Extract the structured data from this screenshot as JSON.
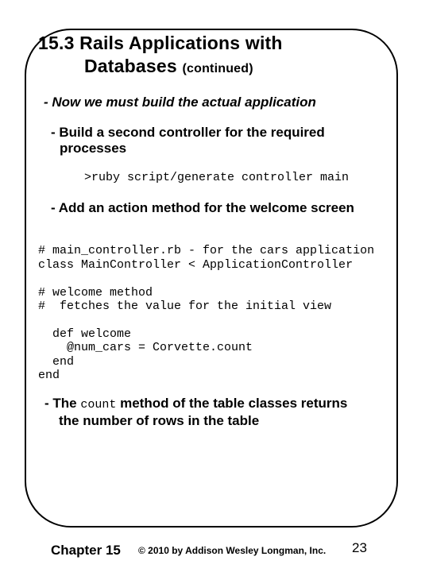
{
  "slide": {
    "title_line1": "15.3 Rails Applications with",
    "title_line2": "Databases",
    "title_suffix": "(continued)",
    "bullets": {
      "main": "- Now we must build the actual application",
      "sub1_line1": "- Build a second controller for the required",
      "sub1_line2": "processes",
      "command": ">ruby script/generate controller main",
      "sub2": "- Add an action method for the welcome screen",
      "sub3_prefix": "- The",
      "sub3_code": "count",
      "sub3_suffix": "method of the table classes returns",
      "sub3_line2": "the number of rows in the table"
    },
    "code_lines": [
      "# main_controller.rb - for the cars application",
      "class MainController < ApplicationController",
      "",
      "# welcome method",
      "#  fetches the value for the initial view",
      "",
      "  def welcome",
      "    @num_cars = Corvette.count",
      "  end",
      "end"
    ]
  },
  "footer": {
    "chapter": "Chapter 15",
    "copyright": "© 2010 by Addison Wesley Longman, Inc.",
    "page_number": "23"
  }
}
